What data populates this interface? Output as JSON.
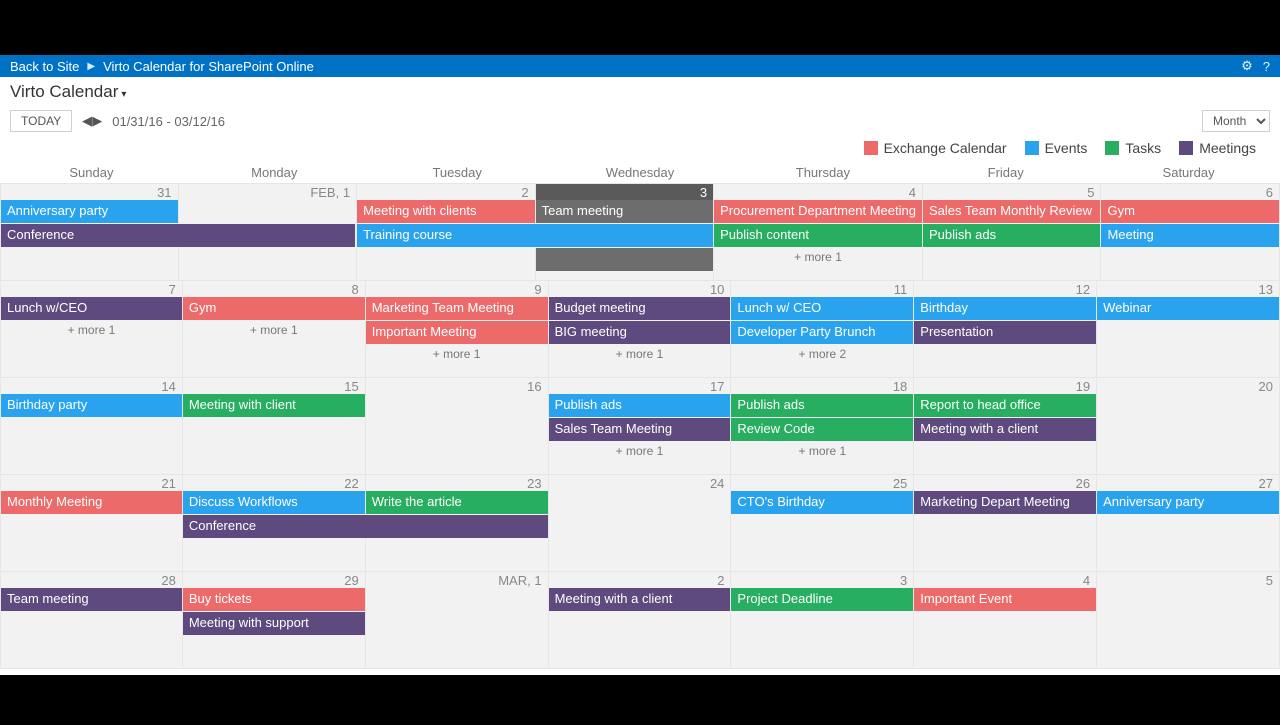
{
  "ribbon": {
    "back": "Back to Site",
    "title": "Virto Calendar for SharePoint Online"
  },
  "page_title": "Virto Calendar",
  "toolbar": {
    "today": "TODAY",
    "range": "01/31/16 - 03/12/16",
    "view": "Month"
  },
  "legend": [
    {
      "label": "Exchange Calendar",
      "color": "#ec6a6a"
    },
    {
      "label": "Events",
      "color": "#2aa3ef"
    },
    {
      "label": "Tasks",
      "color": "#27ae60"
    },
    {
      "label": "Meetings",
      "color": "#5e4a7f"
    }
  ],
  "dow": [
    "Sunday",
    "Monday",
    "Tuesday",
    "Wednesday",
    "Thursday",
    "Friday",
    "Saturday"
  ],
  "weeks": [
    {
      "days": [
        {
          "label": "31",
          "dark": false,
          "events": [
            {
              "t": "Anniversary party",
              "c": "blue",
              "span": 1
            },
            {
              "t": "Conference",
              "c": "purple",
              "span": 2
            }
          ],
          "more": null
        },
        {
          "label": "FEB, 1",
          "dark": false,
          "events": [
            null,
            null
          ],
          "more": null
        },
        {
          "label": "2",
          "dark": false,
          "events": [
            {
              "t": "Meeting with clients",
              "c": "red",
              "span": 1
            },
            {
              "t": "Training course",
              "c": "blue",
              "span": 2
            }
          ],
          "more": null
        },
        {
          "label": "3",
          "dark": true,
          "events": [
            {
              "t": "Team meeting",
              "c": "gray",
              "span": 1
            },
            null,
            {
              "t": "",
              "c": "gray",
              "span": 1
            }
          ],
          "more": null
        },
        {
          "label": "4",
          "dark": false,
          "events": [
            {
              "t": "Procurement Department Meeting",
              "c": "red",
              "span": 1
            },
            {
              "t": "Publish content",
              "c": "green",
              "span": 1
            }
          ],
          "more": "+ more 1"
        },
        {
          "label": "5",
          "dark": false,
          "events": [
            {
              "t": "Sales Team Monthly Review",
              "c": "red",
              "span": 1
            },
            {
              "t": "Publish ads",
              "c": "green",
              "span": 1
            }
          ],
          "more": null
        },
        {
          "label": "6",
          "dark": false,
          "events": [
            {
              "t": "Gym",
              "c": "red",
              "span": 1
            },
            {
              "t": "Meeting",
              "c": "blue",
              "span": 1
            }
          ],
          "more": null
        }
      ]
    },
    {
      "days": [
        {
          "label": "7",
          "dark": false,
          "events": [
            {
              "t": "Lunch w/CEO",
              "c": "purple",
              "span": 1
            }
          ],
          "more": "+ more 1"
        },
        {
          "label": "8",
          "dark": false,
          "events": [
            {
              "t": "Gym",
              "c": "red",
              "span": 1
            }
          ],
          "more": "+ more 1"
        },
        {
          "label": "9",
          "dark": false,
          "events": [
            {
              "t": "Marketing Team Meeting",
              "c": "red",
              "span": 1
            },
            {
              "t": "Important Meeting",
              "c": "red",
              "span": 1
            }
          ],
          "more": "+ more 1"
        },
        {
          "label": "10",
          "dark": false,
          "events": [
            {
              "t": "Budget meeting",
              "c": "purple",
              "span": 1
            },
            {
              "t": "BIG meeting",
              "c": "purple",
              "span": 1
            }
          ],
          "more": "+ more 1"
        },
        {
          "label": "11",
          "dark": false,
          "events": [
            {
              "t": "Lunch w/ CEO",
              "c": "blue",
              "span": 1
            },
            {
              "t": "Developer Party Brunch",
              "c": "blue",
              "span": 1
            }
          ],
          "more": "+ more 2"
        },
        {
          "label": "12",
          "dark": false,
          "events": [
            {
              "t": "Birthday",
              "c": "blue",
              "span": 1
            },
            {
              "t": "Presentation",
              "c": "purple",
              "span": 1
            }
          ],
          "more": null
        },
        {
          "label": "13",
          "dark": false,
          "events": [
            {
              "t": "Webinar",
              "c": "blue",
              "span": 1
            }
          ],
          "more": null
        }
      ]
    },
    {
      "days": [
        {
          "label": "14",
          "dark": false,
          "events": [
            {
              "t": "Birthday party",
              "c": "blue",
              "span": 1
            }
          ],
          "more": null
        },
        {
          "label": "15",
          "dark": false,
          "events": [
            {
              "t": "Meeting with client",
              "c": "green",
              "span": 1
            }
          ],
          "more": null
        },
        {
          "label": "16",
          "dark": false,
          "events": [],
          "more": null
        },
        {
          "label": "17",
          "dark": false,
          "events": [
            {
              "t": "Publish ads",
              "c": "blue",
              "span": 1
            },
            {
              "t": "Sales Team Meeting",
              "c": "purple",
              "span": 1
            }
          ],
          "more": "+ more 1"
        },
        {
          "label": "18",
          "dark": false,
          "events": [
            {
              "t": "Publish ads",
              "c": "green",
              "span": 1
            },
            {
              "t": "Review Code",
              "c": "green",
              "span": 1
            }
          ],
          "more": "+ more 1"
        },
        {
          "label": "19",
          "dark": false,
          "events": [
            {
              "t": "Report to head office",
              "c": "green",
              "span": 1
            },
            {
              "t": "Meeting with a client",
              "c": "purple",
              "span": 1
            }
          ],
          "more": null
        },
        {
          "label": "20",
          "dark": false,
          "events": [],
          "more": null
        }
      ]
    },
    {
      "days": [
        {
          "label": "21",
          "dark": false,
          "events": [
            {
              "t": "Monthly Meeting",
              "c": "red",
              "span": 1
            }
          ],
          "more": null
        },
        {
          "label": "22",
          "dark": false,
          "events": [
            {
              "t": "Discuss Workflows",
              "c": "blue",
              "span": 1
            },
            {
              "t": "Conference",
              "c": "purple",
              "span": 2
            }
          ],
          "more": null
        },
        {
          "label": "23",
          "dark": false,
          "events": [
            {
              "t": "Write the article",
              "c": "green",
              "span": 1
            },
            null
          ],
          "more": null
        },
        {
          "label": "24",
          "dark": false,
          "events": [],
          "more": null
        },
        {
          "label": "25",
          "dark": false,
          "events": [
            {
              "t": "CTO's Birthday",
              "c": "blue",
              "span": 1
            }
          ],
          "more": null
        },
        {
          "label": "26",
          "dark": false,
          "events": [
            {
              "t": "Marketing Depart Meeting",
              "c": "purple",
              "span": 1
            }
          ],
          "more": null
        },
        {
          "label": "27",
          "dark": false,
          "events": [
            {
              "t": "Anniversary party",
              "c": "blue",
              "span": 1
            }
          ],
          "more": null
        }
      ]
    },
    {
      "days": [
        {
          "label": "28",
          "dark": false,
          "events": [
            {
              "t": "Team meeting",
              "c": "purple",
              "span": 1
            }
          ],
          "more": null
        },
        {
          "label": "29",
          "dark": false,
          "events": [
            {
              "t": "Buy tickets",
              "c": "red",
              "span": 1
            },
            {
              "t": "Meeting with support",
              "c": "purple",
              "span": 1
            }
          ],
          "more": null
        },
        {
          "label": "MAR, 1",
          "dark": false,
          "events": [],
          "more": null
        },
        {
          "label": "2",
          "dark": false,
          "events": [
            {
              "t": "Meeting with a client",
              "c": "purple",
              "span": 1
            }
          ],
          "more": null
        },
        {
          "label": "3",
          "dark": false,
          "events": [
            {
              "t": "Project Deadline",
              "c": "green",
              "span": 1
            }
          ],
          "more": null
        },
        {
          "label": "4",
          "dark": false,
          "events": [
            {
              "t": "Important Event",
              "c": "red",
              "span": 1
            }
          ],
          "more": null
        },
        {
          "label": "5",
          "dark": false,
          "events": [],
          "more": null
        }
      ]
    }
  ]
}
